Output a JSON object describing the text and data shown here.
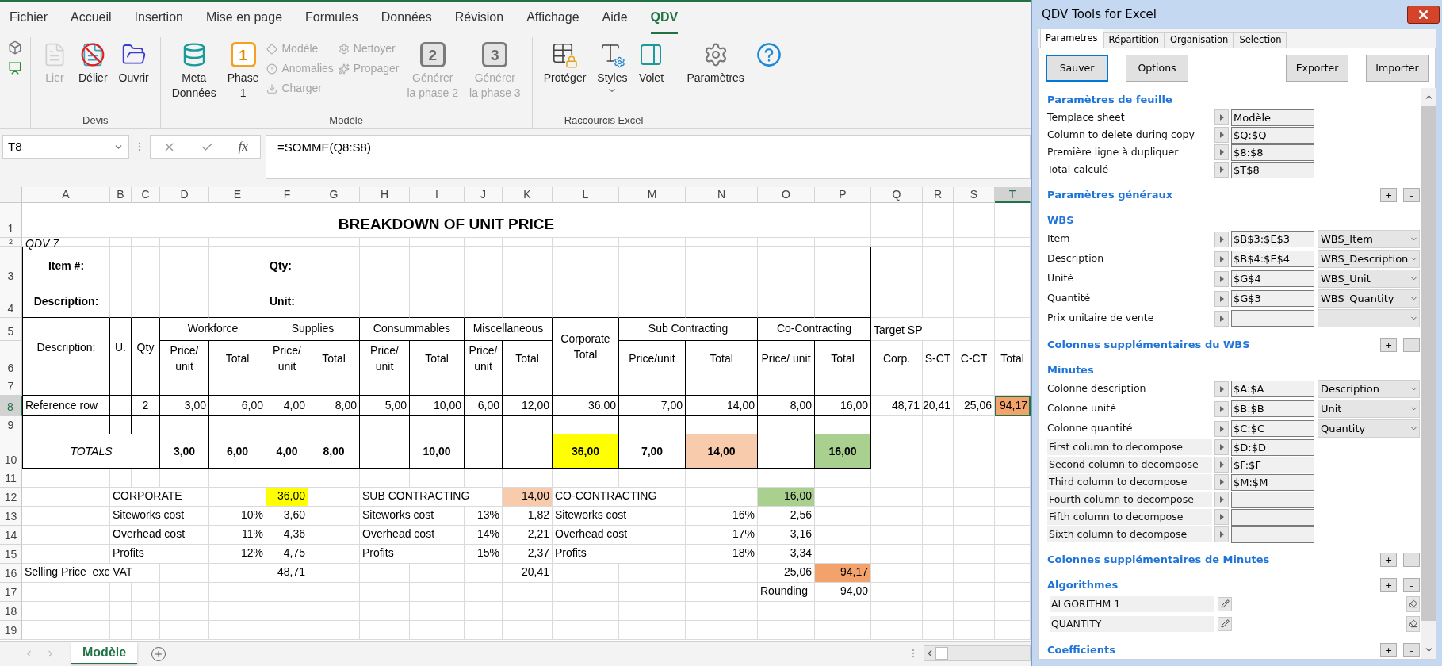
{
  "ribbon": {
    "tabs": [
      {
        "label": "Fichier",
        "selected": false
      },
      {
        "label": "Accueil",
        "selected": false
      },
      {
        "label": "Insertion",
        "selected": false
      },
      {
        "label": "Mise en page",
        "selected": false
      },
      {
        "label": "Formules",
        "selected": false
      },
      {
        "label": "Données",
        "selected": false
      },
      {
        "label": "Révision",
        "selected": false
      },
      {
        "label": "Affichage",
        "selected": false
      },
      {
        "label": "Aide",
        "selected": false
      },
      {
        "label": "QDV",
        "selected": true
      }
    ],
    "groups": [
      {
        "label": "Devis",
        "items": [
          {
            "label": "Lier",
            "kind": "large",
            "disabled": true
          },
          {
            "label": "Délier",
            "kind": "large",
            "disabled": false
          },
          {
            "label": "Ouvrir",
            "kind": "large",
            "disabled": false
          }
        ]
      },
      {
        "label": "Modèle",
        "items": [
          {
            "label": "Meta\nDonnées",
            "kind": "large",
            "disabled": false
          },
          {
            "label": "Phase\n1",
            "kind": "large",
            "disabled": false,
            "badge": "1"
          },
          {
            "label": "Modèle",
            "kind": "small",
            "disabled": true
          },
          {
            "label": "Anomalies",
            "kind": "small",
            "disabled": true
          },
          {
            "label": "Charger",
            "kind": "small",
            "disabled": true
          },
          {
            "label": "Nettoyer",
            "kind": "small",
            "disabled": true
          },
          {
            "label": "Propager",
            "kind": "small",
            "disabled": true
          },
          {
            "label": "Générer\nla phase 2",
            "kind": "large",
            "disabled": true,
            "badge": "2"
          },
          {
            "label": "Générer\nla phase 3",
            "kind": "large",
            "disabled": true,
            "badge": "3"
          }
        ]
      },
      {
        "label": "Raccourcis Excel",
        "items": [
          {
            "label": "Protéger",
            "kind": "large",
            "disabled": false
          },
          {
            "label": "Styles",
            "kind": "split",
            "disabled": false
          },
          {
            "label": "Volet",
            "kind": "large",
            "disabled": false
          }
        ]
      },
      {
        "items": [
          {
            "label": "Paramètres",
            "kind": "large",
            "disabled": false
          },
          {
            "kind": "large",
            "disabled": false
          }
        ]
      }
    ]
  },
  "formula_bar": {
    "name_box": "T8",
    "function_label": "fx",
    "formula": "=SOMME(Q8:S8)"
  },
  "sheet": {
    "columns": [
      {
        "label": "A",
        "selected": false
      },
      {
        "label": "B",
        "selected": false
      },
      {
        "label": "C",
        "selected": false
      },
      {
        "label": "D",
        "selected": false
      },
      {
        "label": "E",
        "selected": false
      },
      {
        "label": "F",
        "selected": false
      },
      {
        "label": "G",
        "selected": false
      },
      {
        "label": "H",
        "selected": false
      },
      {
        "label": "I",
        "selected": false
      },
      {
        "label": "J",
        "selected": false
      },
      {
        "label": "K",
        "selected": false
      },
      {
        "label": "L",
        "selected": false
      },
      {
        "label": "M",
        "selected": false
      },
      {
        "label": "N",
        "selected": false
      },
      {
        "label": "O",
        "selected": false
      },
      {
        "label": "P",
        "selected": false
      },
      {
        "label": "Q",
        "selected": false
      },
      {
        "label": "R",
        "selected": false
      },
      {
        "label": "S",
        "selected": false
      },
      {
        "label": "T",
        "selected": true
      }
    ],
    "rows": [
      {
        "label": "1",
        "selected": false,
        "cells": [
          {
            "kind": "title",
            "text": "BREAKDOWN OF UNIT PRICE"
          }
        ]
      },
      {
        "label": "2",
        "selected": false,
        "cells": [
          {
            "kind": "note",
            "text": "QDV 7"
          }
        ]
      },
      {
        "label": "3",
        "selected": false,
        "cells": [
          {
            "kind": "bold-center",
            "text": "Item #:"
          },
          null,
          null,
          null,
          null,
          {
            "kind": "bold",
            "text": "Qty:"
          }
        ]
      },
      {
        "label": "4",
        "selected": false,
        "cells": [
          {
            "kind": "bold-center",
            "text": "Description:"
          },
          null,
          null,
          null,
          null,
          {
            "kind": "bold",
            "text": "Unit:"
          }
        ]
      },
      {
        "label": "5",
        "selected": false,
        "cells": [
          {
            "kind": "head-small",
            "text": "Description:"
          },
          {
            "kind": "head-small",
            "text": "U."
          },
          {
            "kind": "head-small",
            "text": "Qty"
          },
          {
            "kind": "head",
            "text": "Workforce"
          },
          null,
          {
            "kind": "head",
            "text": "Supplies"
          },
          null,
          {
            "kind": "head",
            "text": "Consummables"
          },
          null,
          {
            "kind": "head",
            "text": "Miscellaneous"
          },
          null,
          {
            "kind": "head",
            "text": "Corporate Total"
          },
          {
            "kind": "head",
            "text": "Sub Contracting"
          },
          null,
          {
            "kind": "head",
            "text": "Co-Contracting"
          },
          null,
          {
            "kind": "text",
            "text": "Target SP"
          }
        ]
      },
      {
        "label": "6",
        "selected": false,
        "cells": [
          null,
          null,
          null,
          {
            "kind": "head",
            "text": "Price/ unit"
          },
          {
            "kind": "head",
            "text": "Total"
          },
          {
            "kind": "head",
            "text": "Price/ unit"
          },
          {
            "kind": "head",
            "text": "Total"
          },
          {
            "kind": "head",
            "text": "Price/ unit"
          },
          {
            "kind": "head",
            "text": "Total"
          },
          {
            "kind": "head",
            "text": "Price/ unit"
          },
          {
            "kind": "head",
            "text": "Total"
          },
          null,
          {
            "kind": "head",
            "text": "Price/unit"
          },
          {
            "kind": "head",
            "text": "Total"
          },
          {
            "kind": "head",
            "text": "Price/ unit"
          },
          {
            "kind": "head",
            "text": "Total"
          },
          {
            "kind": "head",
            "text": "Corp."
          },
          {
            "kind": "head",
            "text": "S-CT"
          },
          {
            "kind": "head",
            "text": "C-CT"
          },
          {
            "kind": "head",
            "text": "Total"
          }
        ]
      },
      {
        "label": "7",
        "selected": false
      },
      {
        "label": "8",
        "selected": true,
        "cells": [
          {
            "kind": "text",
            "text": "Reference row"
          },
          null,
          {
            "kind": "center",
            "text": "2"
          },
          {
            "kind": "num",
            "text": "3,00"
          },
          {
            "kind": "num",
            "text": "6,00"
          },
          {
            "kind": "num",
            "text": "4,00"
          },
          {
            "kind": "num",
            "text": "8,00"
          },
          {
            "kind": "num",
            "text": "5,00"
          },
          {
            "kind": "num",
            "text": "10,00"
          },
          {
            "kind": "num",
            "text": "6,00"
          },
          {
            "kind": "num",
            "text": "12,00"
          },
          {
            "kind": "num",
            "text": "36,00"
          },
          {
            "kind": "num",
            "text": "7,00"
          },
          {
            "kind": "num",
            "text": "14,00"
          },
          {
            "kind": "num",
            "text": "8,00"
          },
          {
            "kind": "num",
            "text": "16,00"
          },
          {
            "kind": "num",
            "text": "48,71"
          },
          {
            "kind": "num",
            "text": "20,41"
          },
          {
            "kind": "num",
            "text": "25,06"
          },
          {
            "kind": "num",
            "text": "94,17",
            "color": "#f4a26b"
          }
        ]
      },
      {
        "label": "9",
        "selected": false
      },
      {
        "label": "10",
        "selected": false,
        "cells": [
          {
            "kind": "total-label",
            "text": "TOTALS"
          },
          null,
          null,
          {
            "kind": "total",
            "text": "3,00"
          },
          {
            "kind": "total",
            "text": "6,00"
          },
          {
            "kind": "total",
            "text": "4,00"
          },
          {
            "kind": "total",
            "text": "8,00"
          },
          null,
          {
            "kind": "total",
            "text": "10,00"
          },
          null,
          null,
          {
            "kind": "total",
            "text": "36,00",
            "color": "#ffff00"
          },
          {
            "kind": "total",
            "text": "7,00"
          },
          {
            "kind": "total",
            "text": "14,00",
            "color": "#f8cbad"
          },
          null,
          {
            "kind": "total",
            "text": "16,00",
            "color": "#a9d08e"
          }
        ]
      },
      {
        "label": "11",
        "selected": false
      },
      {
        "label": "12",
        "selected": false,
        "cells": [
          null,
          {
            "kind": "text",
            "text": "CORPORATE"
          },
          null,
          null,
          null,
          {
            "kind": "num",
            "text": "36,00",
            "color": "#ffff00"
          },
          null,
          {
            "kind": "text",
            "text": "SUB CONTRACTING"
          },
          null,
          null,
          {
            "kind": "num",
            "text": "14,00",
            "color": "#f8cbad"
          },
          {
            "kind": "text",
            "text": "CO-CONTRACTING"
          },
          null,
          null,
          {
            "kind": "num",
            "text": "16,00",
            "color": "#a9d08e"
          }
        ]
      },
      {
        "label": "13",
        "selected": false,
        "cells": [
          null,
          {
            "kind": "text",
            "text": "Siteworks cost"
          },
          null,
          null,
          {
            "kind": "num",
            "text": "10%"
          },
          {
            "kind": "num",
            "text": "3,60"
          },
          null,
          {
            "kind": "text",
            "text": "Siteworks cost"
          },
          null,
          {
            "kind": "num",
            "text": "13%"
          },
          {
            "kind": "num",
            "text": "1,82"
          },
          {
            "kind": "text",
            "text": "Siteworks cost"
          },
          null,
          {
            "kind": "num",
            "text": "16%"
          },
          {
            "kind": "num",
            "text": "2,56"
          }
        ]
      },
      {
        "label": "14",
        "selected": false,
        "cells": [
          null,
          {
            "kind": "text",
            "text": "Overhead cost"
          },
          null,
          null,
          {
            "kind": "num",
            "text": "11%"
          },
          {
            "kind": "num",
            "text": "4,36"
          },
          null,
          {
            "kind": "text",
            "text": "Overhead cost"
          },
          null,
          {
            "kind": "num",
            "text": "14%"
          },
          {
            "kind": "num",
            "text": "2,21"
          },
          {
            "kind": "text",
            "text": "Overhead cost"
          },
          null,
          {
            "kind": "num",
            "text": "17%"
          },
          {
            "kind": "num",
            "text": "3,16"
          }
        ]
      },
      {
        "label": "15",
        "selected": false,
        "cells": [
          null,
          {
            "kind": "text",
            "text": "Profits"
          },
          null,
          null,
          {
            "kind": "num",
            "text": "12%"
          },
          {
            "kind": "num",
            "text": "4,75"
          },
          null,
          {
            "kind": "text",
            "text": "Profits"
          },
          null,
          {
            "kind": "num",
            "text": "15%"
          },
          {
            "kind": "num",
            "text": "2,37"
          },
          {
            "kind": "text",
            "text": "Profits"
          },
          null,
          {
            "kind": "num",
            "text": "18%"
          },
          {
            "kind": "num",
            "text": "3,34"
          }
        ]
      },
      {
        "label": "16",
        "selected": false,
        "cells": [
          {
            "kind": "text",
            "text": "Selling Price  exc VAT"
          },
          null,
          null,
          null,
          null,
          {
            "kind": "num",
            "text": "48,71"
          },
          null,
          null,
          null,
          null,
          {
            "kind": "num",
            "text": "20,41"
          },
          null,
          null,
          null,
          {
            "kind": "num",
            "text": "25,06"
          },
          {
            "kind": "num",
            "text": "94,17",
            "color": "#f4a26b"
          }
        ]
      },
      {
        "label": "17",
        "selected": false,
        "cells": [
          null,
          null,
          null,
          null,
          null,
          null,
          null,
          null,
          null,
          null,
          null,
          null,
          null,
          null,
          {
            "kind": "text",
            "text": "Rounding"
          },
          {
            "kind": "num",
            "text": "94,00"
          }
        ]
      },
      {
        "label": "18",
        "selected": false
      },
      {
        "label": "19",
        "selected": false
      }
    ]
  },
  "sheet_tabs": [
    {
      "label": "Modèle",
      "selected": true
    }
  ],
  "panel": {
    "title": "QDV Tools for Excel",
    "tabs": [
      {
        "label": "Parametres",
        "selected": true
      },
      {
        "label": "Répartition",
        "selected": false
      },
      {
        "label": "Organisation",
        "selected": false
      },
      {
        "label": "Selection",
        "selected": false
      }
    ],
    "buttons": [
      {
        "label": "Sauver",
        "focused": true
      },
      {
        "label": "Options",
        "focused": false
      },
      {
        "label": "Exporter",
        "focused": false
      },
      {
        "label": "Importer",
        "focused": false
      }
    ],
    "sections": [
      {
        "title": "Paramètres de feuille",
        "rows": [
          {
            "kind": "ref",
            "label": "Templace sheet",
            "value": "Modèle"
          },
          {
            "kind": "ref",
            "label": "Column to delete during copy",
            "value": "$Q:$Q"
          },
          {
            "kind": "ref",
            "label": "Première ligne à dupliquer",
            "value": "$8:$8"
          },
          {
            "kind": "ref",
            "label": "Total calculé",
            "value": "$T$8"
          }
        ]
      },
      {
        "title": "Paramètres généraux",
        "actions": [
          "+",
          "-"
        ]
      },
      {
        "title": "WBS",
        "rows": [
          {
            "kind": "ref-select",
            "label": "Item",
            "value": "$B$3:$E$3",
            "option": "WBS_Item"
          },
          {
            "kind": "ref-select",
            "label": "Description",
            "value": "$B$4:$E$4",
            "option": "WBS_Description"
          },
          {
            "kind": "ref-select",
            "label": "Unité",
            "value": "$G$4",
            "option": "WBS_Unit"
          },
          {
            "kind": "ref-select",
            "label": "Quantité",
            "value": "$G$3",
            "option": "WBS_Quantity"
          },
          {
            "kind": "ref-select",
            "label": "Prix unitaire de vente"
          }
        ]
      },
      {
        "title": "Colonnes supplémentaires du WBS",
        "actions": [
          "+",
          "-"
        ]
      },
      {
        "title": "Minutes",
        "rows": [
          {
            "kind": "ref-select",
            "label": "Colonne description",
            "value": "$A:$A",
            "option": "Description"
          },
          {
            "kind": "ref-select",
            "label": "Colonne unité",
            "value": "$B:$B",
            "option": "Unit"
          },
          {
            "kind": "ref-select",
            "label": "Colonne quantité",
            "value": "$C:$C",
            "option": "Quantity"
          },
          {
            "kind": "decompose",
            "label": "First column to decompose",
            "value": "$D:$D"
          },
          {
            "kind": "decompose",
            "label": "Second column to decompose",
            "value": "$F:$F"
          },
          {
            "kind": "decompose",
            "label": "Third column to decompose",
            "value": "$M:$M"
          },
          {
            "kind": "decompose",
            "label": "Fourth column to decompose"
          },
          {
            "kind": "decompose",
            "label": "Fifth column to decompose"
          },
          {
            "kind": "decompose",
            "label": "Sixth column to decompose"
          }
        ]
      },
      {
        "title": "Colonnes supplémentaires de Minutes",
        "actions": [
          "+",
          "-"
        ]
      },
      {
        "title": "Algorithmes",
        "actions": [
          "+",
          "-"
        ],
        "rows": [
          {
            "kind": "algorithm",
            "label": "ALGORITHM 1"
          },
          {
            "kind": "algorithm",
            "label": "QUANTITY"
          }
        ]
      },
      {
        "title": "Coefficients",
        "actions": [
          "+",
          "-"
        ]
      }
    ]
  }
}
